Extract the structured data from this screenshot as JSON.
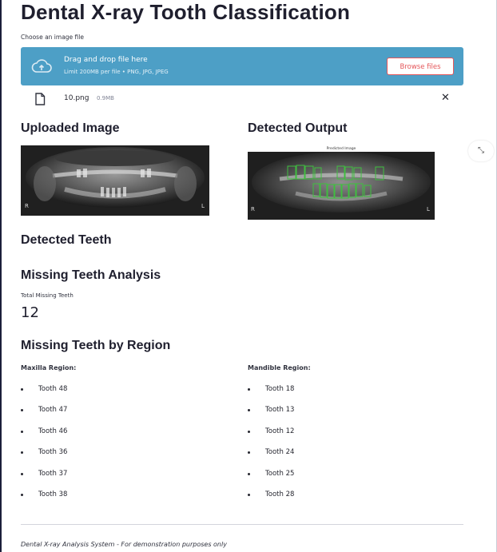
{
  "page": {
    "title": "Dental X-ray Tooth Classification"
  },
  "uploader": {
    "label": "Choose an image file",
    "drop_text": "Drag and drop file here",
    "limit_text": "Limit 200MB per file • PNG, JPG, JPEG",
    "browse_label": "Browse files",
    "upload_icon": "cloud-upload-icon"
  },
  "file": {
    "icon": "file-icon",
    "name": "10.png",
    "size": "0.9MB",
    "close_glyph": "✕"
  },
  "sections": {
    "uploaded_image": "Uploaded Image",
    "detected_output": "Detected Output",
    "detected_teeth": "Detected Teeth",
    "missing_analysis": "Missing Teeth Analysis",
    "missing_by_region": "Missing Teeth by Region"
  },
  "images": {
    "predicted_caption": "Predicted Image",
    "left_marker": "R",
    "right_marker": "L"
  },
  "expand": {
    "icon": "fullscreen-expand-icon",
    "glyph": "⤡"
  },
  "metric": {
    "label": "Total Missing Teeth",
    "value": "12"
  },
  "regions": {
    "maxilla": {
      "title": "Maxilla Region:",
      "teeth": [
        "Tooth 48",
        "Tooth 47",
        "Tooth 46",
        "Tooth 36",
        "Tooth 37",
        "Tooth 38"
      ]
    },
    "mandible": {
      "title": "Mandible Region:",
      "teeth": [
        "Tooth 18",
        "Tooth 13",
        "Tooth 12",
        "Tooth 24",
        "Tooth 25",
        "Tooth 28"
      ]
    }
  },
  "footer": {
    "text": "Dental X-ray Analysis System - For demonstration purposes only"
  },
  "colors": {
    "dropzone": "#4d9fc6",
    "browse_accent": "#e4565a",
    "detection_box": "#3fbf3f"
  }
}
